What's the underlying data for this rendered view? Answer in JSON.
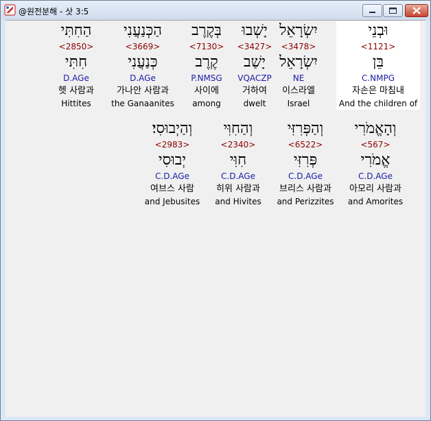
{
  "window": {
    "title": "@원전분해 - 삿 3:5"
  },
  "rows": [
    [
      {
        "heb": "וּבְנֵי",
        "strong": "<1121>",
        "lemma": "בֵּן",
        "parse": "C.NMPG",
        "kor": "자손은 마침내",
        "eng": "And the children of",
        "highlight": true
      },
      {
        "heb": "יִשְׂרָאֵל",
        "strong": "<3478>",
        "lemma": "יִשְׂרָאֵל",
        "parse": "NE",
        "kor": "이스라엘",
        "eng": "Israel"
      },
      {
        "heb": "יָשְׁבוּ",
        "strong": "<3427>",
        "lemma": "יָשַׁב",
        "parse": "VQACZP",
        "kor": "거하여",
        "eng": "dwelt"
      },
      {
        "heb": "בְּקֶרֶב",
        "strong": "<7130>",
        "lemma": "קֶרֶב",
        "parse": "P.NMSG",
        "kor": "사이에",
        "eng": "among"
      },
      {
        "heb": "הַכְּנַעֲנִי",
        "strong": "<3669>",
        "lemma": "כְּנַעֲנִי",
        "parse": "D.AGe",
        "kor": "가나안 사람과",
        "eng": "the Ganaanites"
      },
      {
        "heb": "הַחִתִּי",
        "strong": "<2850>",
        "lemma": "חִתִּי",
        "parse": "D.AGe",
        "kor": "헷 사람과",
        "eng": "Hittites"
      }
    ],
    [
      {
        "heb": "וְהָאֱמֹרִי",
        "strong": "<567>",
        "lemma": "אֱמֹרִי",
        "parse": "C.D.AGe",
        "kor": "아모리 사람과",
        "eng": "and Amorites"
      },
      {
        "heb": "וְהַפְּרִזִּי",
        "strong": "<6522>",
        "lemma": "פְּרִזִּי",
        "parse": "C.D.AGe",
        "kor": "브리스 사람과",
        "eng": "and Perizzites"
      },
      {
        "heb": "וְהַחִוִּי",
        "strong": "<2340>",
        "lemma": "חִוִּי",
        "parse": "C.D.AGe",
        "kor": "히위 사람과",
        "eng": "and Hivites"
      },
      {
        "heb": "וְהַיְבוּסִי׃",
        "strong": "<2983>",
        "lemma": "יְבוּסִי",
        "parse": "C.D.AGe",
        "kor": "여브스 사람",
        "eng": "and Jebusites"
      }
    ]
  ]
}
